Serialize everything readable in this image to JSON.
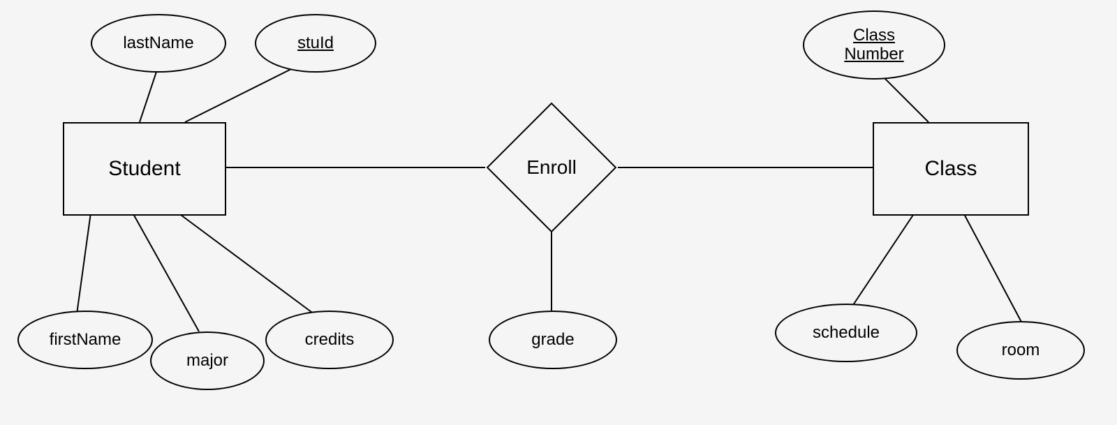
{
  "entities": {
    "student": {
      "label": "Student"
    },
    "class": {
      "label": "Class"
    }
  },
  "relationship": {
    "enroll": {
      "label": "Enroll"
    }
  },
  "attributes": {
    "lastName": {
      "label": "lastName",
      "key": false
    },
    "stuId": {
      "label": "stuId",
      "key": true
    },
    "firstName": {
      "label": "firstName",
      "key": false
    },
    "major": {
      "label": "major",
      "key": false
    },
    "credits": {
      "label": "credits",
      "key": false
    },
    "grade": {
      "label": "grade",
      "key": false
    },
    "classNumber": {
      "label": "Class\nNumber",
      "key": true
    },
    "schedule": {
      "label": "schedule",
      "key": false
    },
    "room": {
      "label": "room",
      "key": false
    }
  }
}
